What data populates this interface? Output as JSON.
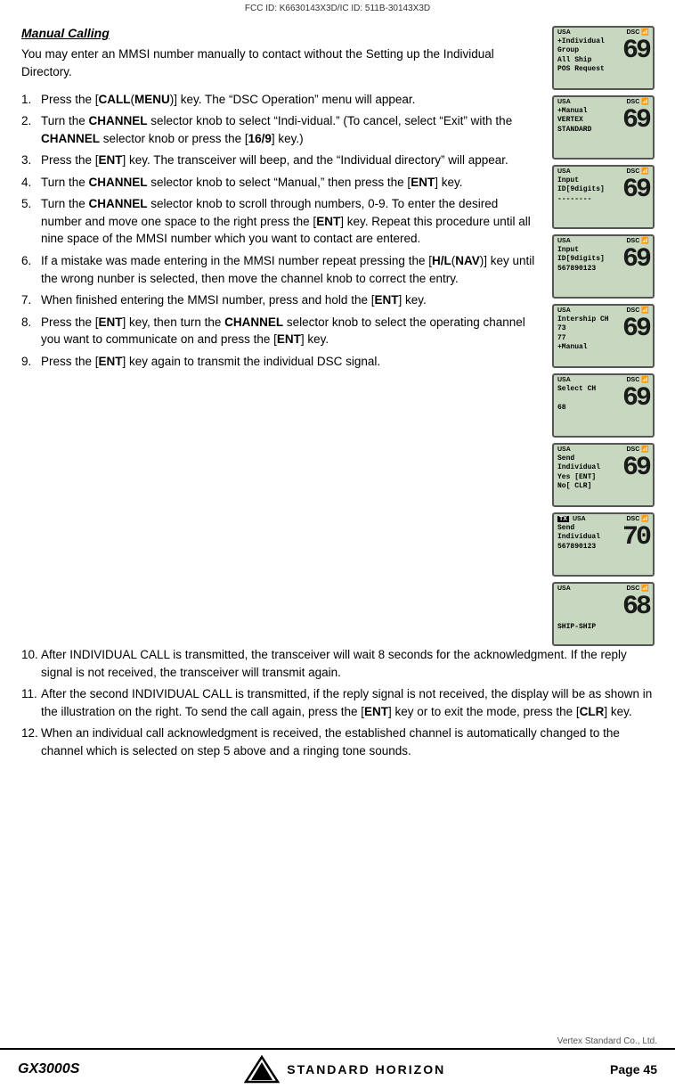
{
  "fcc": {
    "id_text": "FCC ID: K6630143X3D/IC ID: 511B-30143X3D"
  },
  "title": {
    "text": "Manual Calling"
  },
  "intro": {
    "text": "You may enter an MMSI number manually to contact without the Setting up the Individual Directory."
  },
  "steps": [
    {
      "num": "1.",
      "text_parts": [
        {
          "text": "Press the [",
          "bold": false
        },
        {
          "text": "CALL",
          "bold": true
        },
        {
          "text": "(",
          "bold": true
        },
        {
          "text": "MENU",
          "bold": true
        },
        {
          "text": ")] key. The “DSC Operation” menu will appear.",
          "bold": false
        }
      ],
      "plain": "Press the [CALL(MENU)] key. The “DSC Operation” menu will appear."
    },
    {
      "num": "2.",
      "text_parts": [],
      "plain": "Turn the CHANNEL selector knob to select “Indi-vidual.” (To cancel, select “Exit” with the CHANNEL selector knob or press the [16/9] key.)"
    },
    {
      "num": "3.",
      "plain": "Press the [ENT] key. The transceiver will beep, and the “Individual directory” will appear."
    },
    {
      "num": "4.",
      "plain": "Turn the CHANNEL selector knob to select “Manual,” then press the [ENT] key."
    },
    {
      "num": "5.",
      "plain": "Turn the CHANNEL selector knob to scroll through numbers, 0-9. To enter the desired number and move one space to the right press the [ENT] key. Repeat this procedure until all nine space of the MMSI number which you want to contact are entered."
    },
    {
      "num": "6.",
      "plain": "If a mistake was made entering in the MMSI number repeat pressing the [H/L(NAV)] key until the wrong nunber is selected, then move the channel knob to correct the entry."
    },
    {
      "num": "7.",
      "plain": "When finished entering the MMSI number, press and hold the [ENT] key."
    },
    {
      "num": "8.",
      "plain": "Press the [ENT] key, then turn the CHANNEL selector knob to select the operating channel you want to communicate on and press the [ENT] key."
    },
    {
      "num": "9.",
      "plain": "Press the [ENT] key again to transmit the individual DSC signal."
    }
  ],
  "steps_continued": [
    {
      "num": "10.",
      "plain": "After INDIVIDUAL CALL is transmitted, the transceiver will wait 8 seconds for the acknowledgment. If the reply signal is not received, the transceiver will transmit again."
    },
    {
      "num": "11.",
      "plain": "After the second INDIVIDUAL CALL is transmitted, if the reply signal is not received, the display will be as shown in the illustration on the right. To send the call again, press the [ENT] key or to exit the mode, press the [CLR] key."
    },
    {
      "num": "12.",
      "plain": "When an individual call acknowledgment is received, the established channel is automatically changed to the channel which is selected on step 5 above and a ringing tone sounds."
    }
  ],
  "displays": [
    {
      "id": "display-1",
      "usa": "USA",
      "dsc": "DSC",
      "left_lines": [
        "+Individual",
        "Group",
        "All Ship",
        "POS Request"
      ],
      "number": "69",
      "tx": false
    },
    {
      "id": "display-2",
      "usa": "USA",
      "dsc": "DSC",
      "left_lines": [
        "+Manual",
        "VERTEX",
        "STANDARD"
      ],
      "number": "69",
      "tx": false
    },
    {
      "id": "display-3",
      "usa": "USA",
      "dsc": "DSC",
      "left_lines": [
        "Input",
        "ID[9digits]",
        "--------"
      ],
      "number": "69",
      "tx": false
    },
    {
      "id": "display-4",
      "usa": "USA",
      "dsc": "DSC",
      "left_lines": [
        "Input",
        "ID[9digits]",
        "567890123"
      ],
      "number": "69",
      "tx": false
    },
    {
      "id": "display-5",
      "usa": "USA",
      "dsc": "DSC",
      "left_lines": [
        "Intership CH",
        "73",
        "77",
        "+Manual"
      ],
      "number": "69",
      "tx": false
    },
    {
      "id": "display-6",
      "usa": "USA",
      "dsc": "DSC",
      "left_lines": [
        "Select CH",
        "",
        "68"
      ],
      "number": "69",
      "tx": false
    },
    {
      "id": "display-7",
      "usa": "USA",
      "dsc": "DSC",
      "left_lines": [
        "Send",
        "Individual",
        "Yes [ENT]",
        "No[ CLR]"
      ],
      "number": "69",
      "tx": false
    },
    {
      "id": "display-8",
      "usa": "USA",
      "dsc": "DSC",
      "left_lines": [
        "Send",
        "Individual",
        "567890123"
      ],
      "number": "70",
      "tx": true
    },
    {
      "id": "display-9",
      "usa": "USA",
      "dsc": "DSC",
      "left_lines": [],
      "bottom_text": "SHIP-SHIP",
      "number": "68",
      "tx": false
    }
  ],
  "footer": {
    "model": "GX3000S",
    "brand": "STANDARD HORIZON",
    "page_label": "Page",
    "page_number": "45"
  },
  "vertex_credit": "Vertex Standard Co., Ltd."
}
